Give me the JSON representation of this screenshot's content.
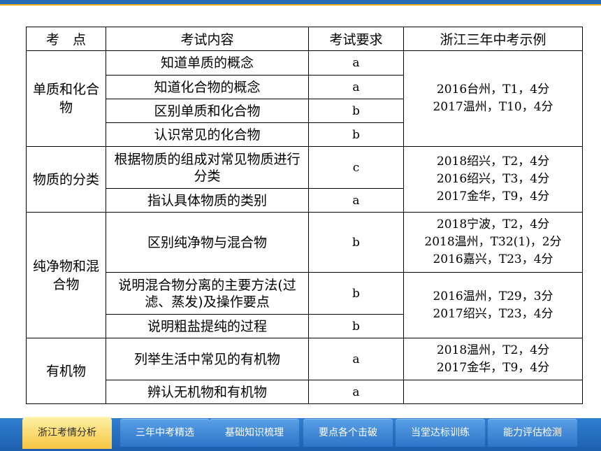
{
  "headers": {
    "topic": "考　点",
    "content": "考试内容",
    "requirement": "考试要求",
    "examples": "浙江三年中考示例"
  },
  "groups": [
    {
      "topic": "单质和化合物",
      "rows": [
        {
          "content": "知道单质的概念",
          "req": "a"
        },
        {
          "content": "知道化合物的概念",
          "req": "a"
        },
        {
          "content": "区别单质和化合物",
          "req": "b"
        },
        {
          "content": "认识常见的化合物",
          "req": "b"
        }
      ],
      "examples": [
        "2016台州，T1，4分",
        "2017温州，T10，4分"
      ]
    },
    {
      "topic": "物质的分类",
      "rows": [
        {
          "content": "根据物质的组成对常见物质进行分类",
          "req": "c"
        },
        {
          "content": "指认具体物质的类别",
          "req": "a"
        }
      ],
      "examples": [
        "2018绍兴，T2，4分",
        "2016绍兴，T3，4分",
        "2017金华，T9，4分"
      ]
    },
    {
      "topic": "纯净物和混合物",
      "rows": [
        {
          "content": "区别纯净物与混合物",
          "req": "b",
          "examples": [
            "2018宁波，T2，4分",
            "2018温州，T32(1)，2分",
            "2016嘉兴，T23，4分"
          ]
        },
        {
          "content": "说明混合物分离的主要方法(过滤、蒸发)及操作要点",
          "req": "b"
        },
        {
          "content": "说明粗盐提纯的过程",
          "req": "b"
        }
      ],
      "examples2": [
        "2016温州，T29，3分",
        "2017绍兴，T23，4分"
      ]
    },
    {
      "topic": "有机物",
      "rows": [
        {
          "content": "列举生活中常见的有机物",
          "req": "a",
          "examples": [
            "2018温州，T2，4分",
            "2017金华，T9，4分"
          ]
        },
        {
          "content": "辨认无机物和有机物",
          "req": "a"
        }
      ]
    }
  ],
  "tabs": [
    {
      "label": "浙江考情分析",
      "active": true
    },
    {
      "label": "三年中考精选",
      "active": false
    },
    {
      "label": "基础知识梳理",
      "active": false
    },
    {
      "label": "要点各个击破",
      "active": false
    },
    {
      "label": "当堂达标训练",
      "active": false
    },
    {
      "label": "能力评估检测",
      "active": false
    }
  ],
  "colors": {
    "nav_blue": "#2a6db5",
    "accent_gold": "#f2b01e",
    "active_tab": "#f5c542"
  }
}
